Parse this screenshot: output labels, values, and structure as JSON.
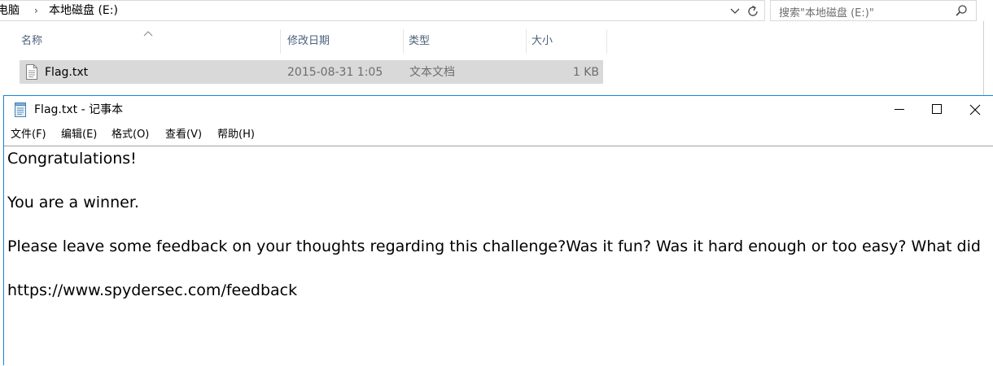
{
  "explorer": {
    "breadcrumb": {
      "part1": "电脑",
      "part2": "本地磁盘 (E:)",
      "separator": "›"
    },
    "search": {
      "placeholder": "搜索\"本地磁盘 (E:)\""
    },
    "columns": {
      "name": "名称",
      "date": "修改日期",
      "type": "类型",
      "size": "大小"
    },
    "files": [
      {
        "name": "Flag.txt",
        "date": "2015-08-31 1:05",
        "type": "文本文档",
        "size": "1 KB"
      }
    ]
  },
  "notepad": {
    "title": "Flag.txt - 记事本",
    "menu": {
      "file": "文件(F)",
      "edit": "编辑(E)",
      "format": "格式(O)",
      "view": "查看(V)",
      "help": "帮助(H)"
    },
    "content": {
      "line1": "Congratulations!",
      "line2": "You are a winner.",
      "line3": "Please leave some feedback on your thoughts regarding this challenge?Was it fun? Was it hard enough or too easy? What did",
      "line4": "https://www.spydersec.com/feedback"
    }
  },
  "colors": {
    "window_border": "#1883d7",
    "selected_row": "#d9d9d9",
    "column_header_text": "#4c607a"
  }
}
